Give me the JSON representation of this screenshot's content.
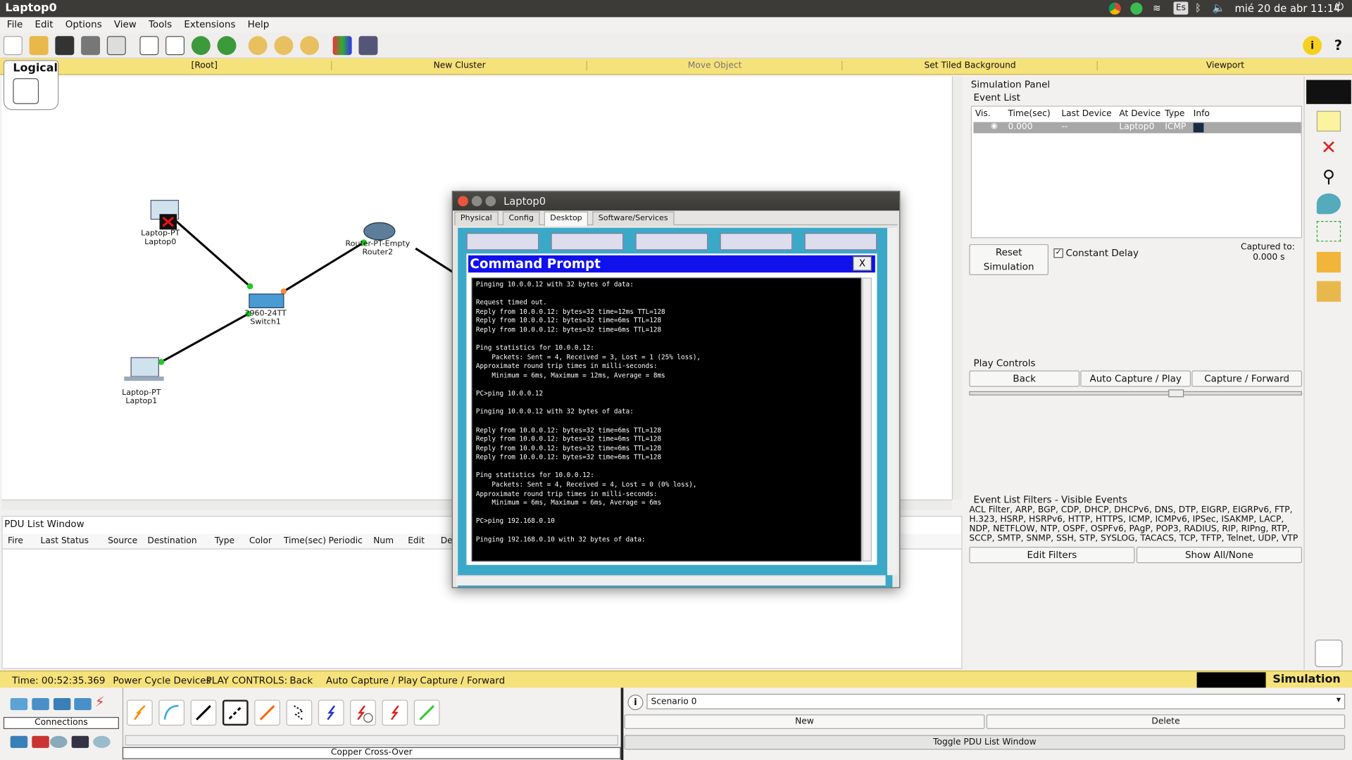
{
  "os": {
    "window_title": "Laptop0",
    "clock": "mié 20 de abr 11:14",
    "keyboard": "Es"
  },
  "menu": [
    "File",
    "Edit",
    "Options",
    "View",
    "Tools",
    "Extensions",
    "Help"
  ],
  "logic_bar": {
    "logical": "Logical",
    "root": "[Root]",
    "new_cluster": "New Cluster",
    "move_object": "Move Object",
    "set_tiled_background": "Set Tiled Background",
    "viewport": "Viewport"
  },
  "topology": {
    "laptop0": {
      "type": "Laptop-PT",
      "name": "Laptop0"
    },
    "laptop1": {
      "type": "Laptop-PT",
      "name": "Laptop1"
    },
    "switch1": {
      "type": "2960-24TT",
      "name": "Switch1"
    },
    "router2": {
      "type": "Router-PT-Empty",
      "name": "Router2"
    }
  },
  "pdu_window": {
    "title": "PDU List Window",
    "columns": [
      "Fire",
      "Last Status",
      "Source",
      "Destination",
      "Type",
      "Color",
      "Time(sec)",
      "Periodic",
      "Num",
      "Edit",
      "Del"
    ]
  },
  "sim_panel": {
    "title": "Simulation Panel",
    "event_list_label": "Event List",
    "columns": [
      "Vis.",
      "Time(sec)",
      "Last Device",
      "At Device",
      "Type",
      "Info"
    ],
    "events": [
      {
        "time": "0.000",
        "last_device": "--",
        "at_device": "Laptop0",
        "type": "ICMP"
      }
    ],
    "reset": "Reset Simulation",
    "constant_delay": "Constant Delay",
    "constant_delay_checked": true,
    "captured_label": "Captured to:",
    "captured_value": "0.000 s",
    "play_controls": "Play Controls",
    "back": "Back",
    "auto_capture": "Auto Capture / Play",
    "capture_forward": "Capture / Forward",
    "filters_label": "Event List Filters - Visible Events",
    "filters_text": "ACL Filter, ARP, BGP, CDP, DHCP, DHCPv6, DNS, DTP, EIGRP, EIGRPv6, FTP, H.323, HSRP, HSRPv6, HTTP, HTTPS, ICMP, ICMPv6, IPSec, ISAKMP, LACP, NDP, NETFLOW, NTP, OSPF, OSPFv6, PAgP, POP3, RADIUS, RIP, RIPng, RTP, SCCP, SMTP, SNMP, SSH, STP, SYSLOG, TACACS, TCP, TFTP, Telnet, UDP, VTP",
    "edit_filters": "Edit Filters",
    "show_all": "Show All/None"
  },
  "status": {
    "time": "Time: 00:52:35.369",
    "power_cycle": "Power Cycle Devices",
    "play_label": "PLAY CONTROLS:",
    "back": "Back",
    "auto": "Auto Capture / Play",
    "forward": "Capture / Forward",
    "mode": "Simulation"
  },
  "bottom": {
    "connections": "Connections",
    "cable_name": "Copper Cross-Over",
    "scenario": "Scenario 0",
    "new": "New",
    "delete": "Delete",
    "toggle_pdu": "Toggle PDU List Window"
  },
  "laptop_window": {
    "title": "Laptop0",
    "tabs": [
      "Physical",
      "Config",
      "Desktop",
      "Software/Services"
    ],
    "active_tab": "Desktop",
    "cmd_title": "Command Prompt",
    "close": "X",
    "terminal": "Pinging 10.0.0.12 with 32 bytes of data:\n\nRequest timed out.\nReply from 10.0.0.12: bytes=32 time=12ms TTL=128\nReply from 10.0.0.12: bytes=32 time=6ms TTL=128\nReply from 10.0.0.12: bytes=32 time=6ms TTL=128\n\nPing statistics for 10.0.0.12:\n    Packets: Sent = 4, Received = 3, Lost = 1 (25% loss),\nApproximate round trip times in milli-seconds:\n    Minimum = 6ms, Maximum = 12ms, Average = 8ms\n\nPC>ping 10.0.0.12\n\nPinging 10.0.0.12 with 32 bytes of data:\n\nReply from 10.0.0.12: bytes=32 time=6ms TTL=128\nReply from 10.0.0.12: bytes=32 time=6ms TTL=128\nReply from 10.0.0.12: bytes=32 time=6ms TTL=128\nReply from 10.0.0.12: bytes=32 time=6ms TTL=128\n\nPing statistics for 10.0.0.12:\n    Packets: Sent = 4, Received = 4, Lost = 0 (0% loss),\nApproximate round trip times in milli-seconds:\n    Minimum = 6ms, Maximum = 6ms, Average = 6ms\n\nPC>ping 192.168.0.10\n\nPinging 192.168.0.10 with 32 bytes of data:"
  },
  "colors": {
    "ubuntu_bar": "#3c3b37",
    "yellow_bar": "#f6e27a",
    "cmd_bar": "#1111ee",
    "desktop": "#3aa9c8"
  }
}
